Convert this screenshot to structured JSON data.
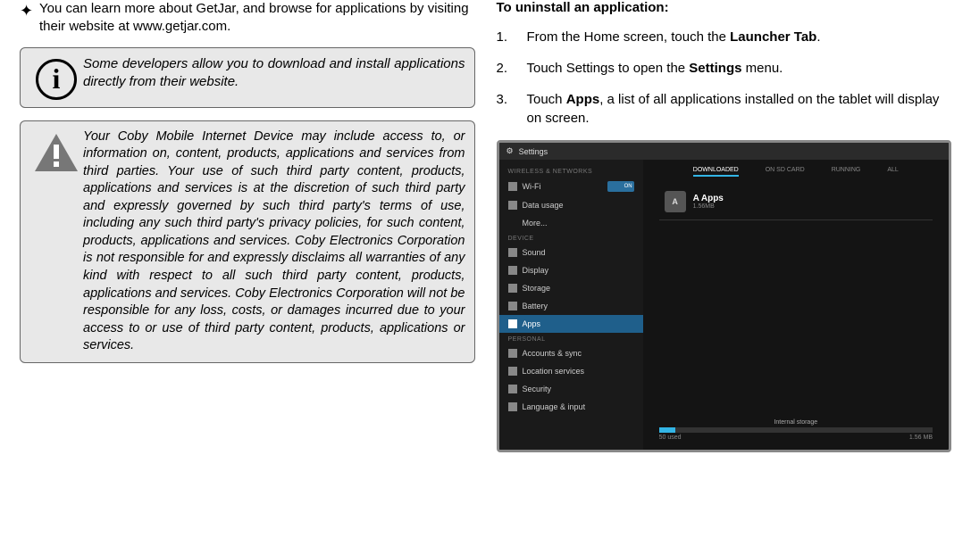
{
  "left": {
    "bullet_text": "You can learn more about GetJar, and browse for applications by visiting their website at www.getjar.com.",
    "info_text": "Some developers allow you to download and install applications directly from their website.",
    "warn_text": "Your Coby Mobile Internet Device may include access to, or information on, content, products, applications and services from third parties. Your use of such third party content, products, applications and services is at the discretion of such third party and expressly governed by such third party's terms of use, including any such third party's privacy policies, for such content, products, applications and services. Coby Electronics Corporation is not responsible for and expressly disclaims all warranties of any kind with respect to all such third party content, products, applications and services. Coby Electronics Corporation will not be responsible for any loss, costs, or damages incurred due to your access to or use of third party content, products, applications or services."
  },
  "right": {
    "title": "To uninstall an application:",
    "steps": [
      {
        "pre": "From the Home screen, touch the ",
        "bold": "Launcher Tab",
        "post": "."
      },
      {
        "pre": "Touch Settings to open the ",
        "bold": "Settings",
        "post": " menu."
      },
      {
        "pre": "Touch ",
        "bold": "Apps",
        "post": ", a list of all applications installed on the tablet will display on screen."
      }
    ]
  },
  "shot": {
    "top_title": "Settings",
    "side": {
      "hdr1": "WIRELESS & NETWORKS",
      "wifi": "Wi-Fi",
      "wifi_state": "ON",
      "data": "Data usage",
      "more": "More...",
      "hdr2": "DEVICE",
      "sound": "Sound",
      "display": "Display",
      "storage": "Storage",
      "battery": "Battery",
      "apps": "Apps",
      "hdr3": "PERSONAL",
      "accounts": "Accounts & sync",
      "location": "Location services",
      "security": "Security",
      "language": "Language & input"
    },
    "tabs": {
      "t1": "DOWNLOADED",
      "t2": "ON SD CARD",
      "t3": "RUNNING",
      "t4": "ALL"
    },
    "app": {
      "name": "A Apps",
      "size": "1.56MB",
      "icon": "A"
    },
    "storage": {
      "label": "Internal storage",
      "used": "50 used",
      "total": "1.56 MB"
    }
  }
}
